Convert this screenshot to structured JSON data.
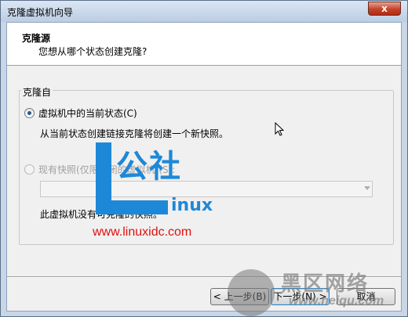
{
  "window": {
    "title": "克隆虚拟机向导",
    "close_label": "x"
  },
  "header": {
    "title": "克隆源",
    "subtitle": "您想从哪个状态创建克隆?"
  },
  "clone_from": {
    "group_label": "克隆自",
    "current_state": {
      "label": "虚拟机中的当前状态(C)",
      "checked": true,
      "description": "从当前状态创建链接克隆将创建一个新快照。"
    },
    "snapshot": {
      "label": "现有快照(仅限关闭的虚拟机)(S):",
      "checked": false,
      "enabled": false,
      "selected_value": "",
      "note": "此虚拟机没有可克隆的快照。"
    }
  },
  "buttons": {
    "back": "< 上一步(B)",
    "next": "下一步(N) >",
    "cancel": "取消"
  },
  "watermarks": {
    "logo_cn": "公社",
    "logo_inux": "inux",
    "site_url": "www.linuxidc.com",
    "brand2_cn": "黑区网络",
    "brand2_url": "www.heiqu.com"
  },
  "colors": {
    "accent_blue": "#1e88d8",
    "url_red": "#e01010"
  }
}
